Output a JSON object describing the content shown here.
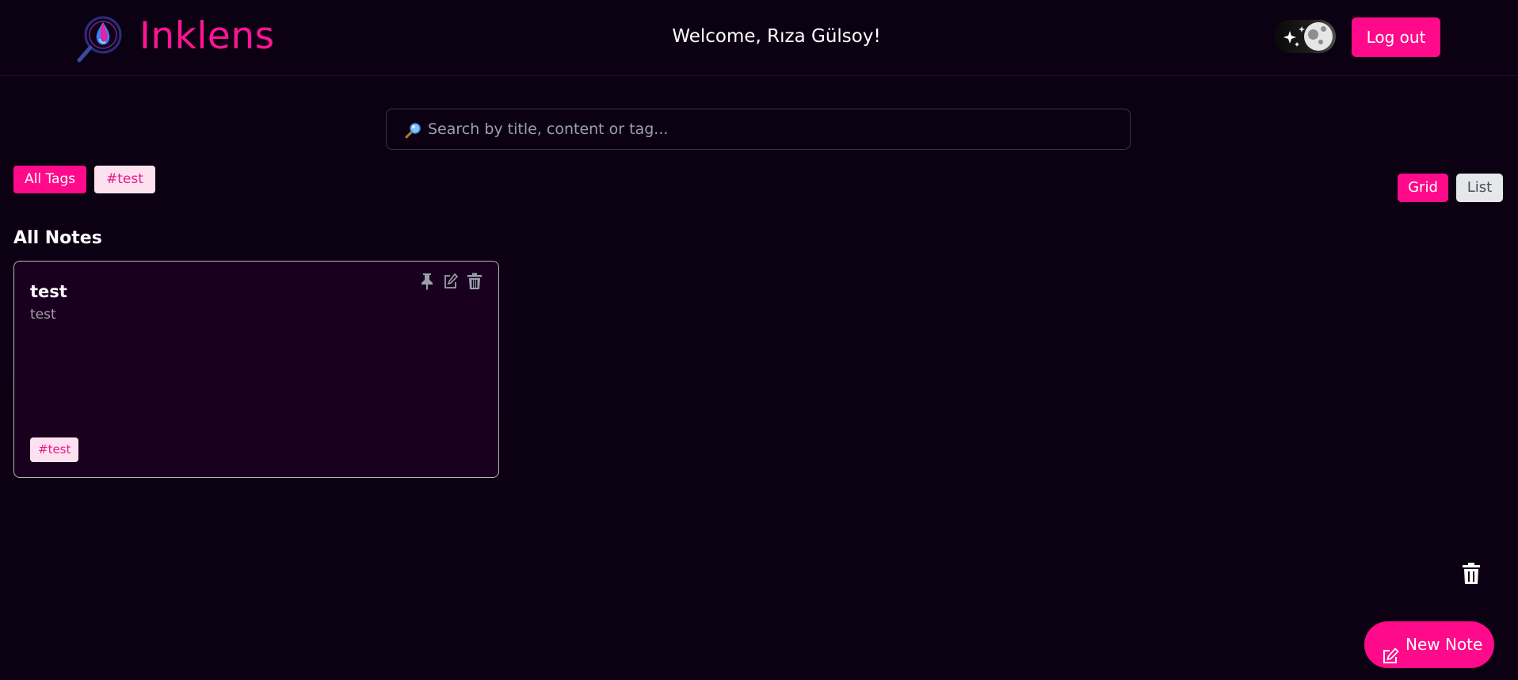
{
  "header": {
    "brand": "Inklens",
    "welcome": "Welcome, Rıza Gülsoy!",
    "logout_label": "Log out",
    "logo_icon": "ink-drop-magnifier-logo-icon",
    "theme_icon": "moon-stars-icon"
  },
  "search": {
    "placeholder": "Search by title, content or tag...",
    "value": "",
    "icon": "magnifier-icon"
  },
  "tags": {
    "all_label": "All Tags",
    "items": [
      "#test"
    ]
  },
  "view": {
    "grid_label": "Grid",
    "list_label": "List",
    "active": "Grid"
  },
  "section": {
    "title": "All Notes"
  },
  "notes": [
    {
      "title": "test",
      "body": "test",
      "tags": [
        "#test"
      ],
      "action_icons": [
        "pin-icon",
        "edit-icon",
        "trash-icon"
      ]
    }
  ],
  "fab": {
    "new_note_label": "New Note",
    "new_note_icon": "edit-icon",
    "trash_icon": "trash-icon"
  },
  "colors": {
    "accent": "#ff0a8a",
    "background": "#0c0112",
    "card": "#1a001f",
    "tag_bg": "#fde1ef",
    "tag_text": "#e8198b"
  }
}
